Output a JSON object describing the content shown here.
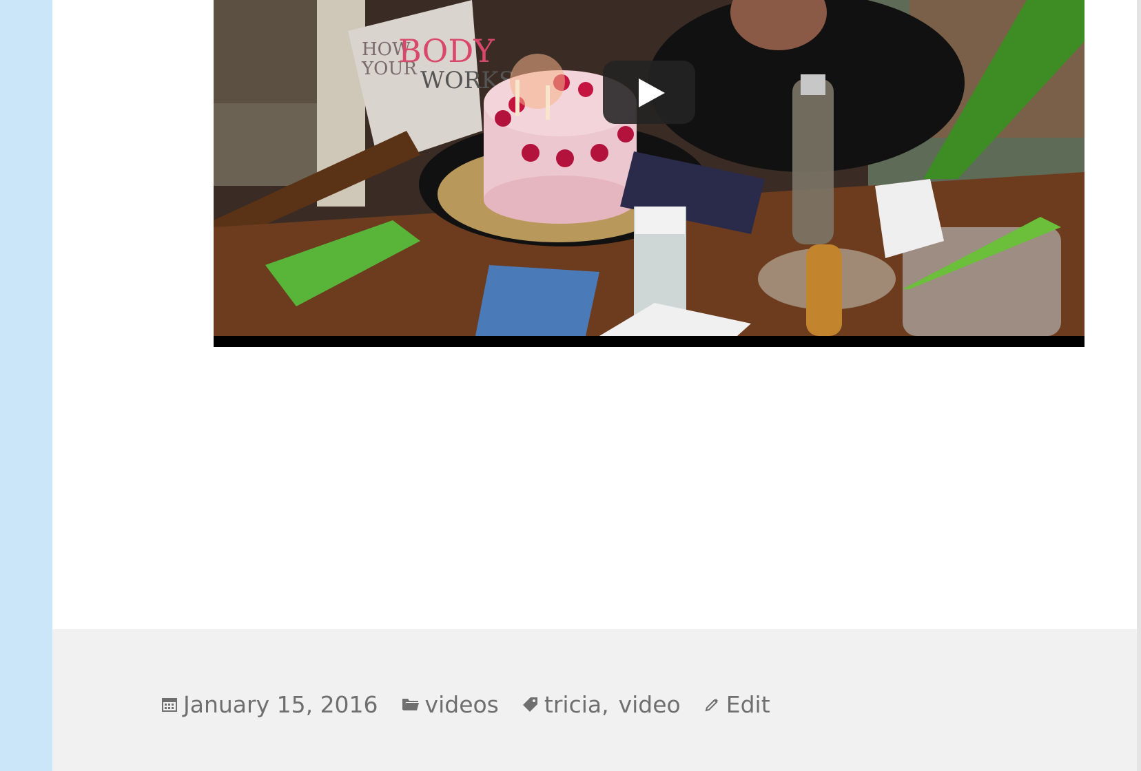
{
  "video": {
    "play_label": "Play",
    "poster_alt": "Birthday cake with candles on table"
  },
  "footer": {
    "posted_on": "January 15, 2016",
    "category": "videos",
    "tags": [
      "tricia",
      "video"
    ],
    "tag_separator": ",",
    "edit_label": "Edit"
  },
  "colors": {
    "page_background": "#cbe6f8",
    "content_background": "#ffffff",
    "footer_background": "#f1f1f1",
    "meta_text": "#6f6f6f"
  },
  "icons": {
    "posted_on": "calendar-icon",
    "category": "folder-icon",
    "tags": "tag-icon",
    "edit": "pencil-icon",
    "video": "play-icon"
  }
}
